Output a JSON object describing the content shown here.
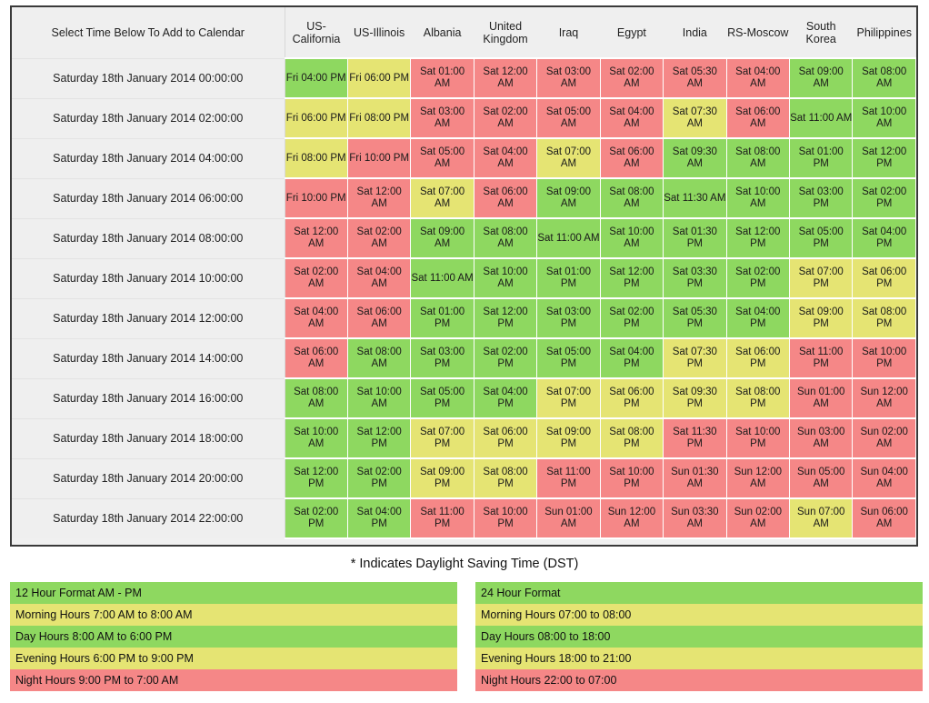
{
  "table": {
    "corner_header": "Select Time Below To Add to Calendar",
    "zone_headers": [
      "US-California",
      "US-Illinois",
      "Albania",
      "United Kingdom",
      "Iraq",
      "Egypt",
      "India",
      "RS-Moscow",
      "South Korea",
      "Philippines"
    ],
    "rows": [
      {
        "label": "Saturday 18th January 2014 00:00:00",
        "cells": [
          {
            "text": "Fri 04:00 PM",
            "color": "green"
          },
          {
            "text": "Fri 06:00 PM",
            "color": "yellow"
          },
          {
            "text": "Sat 01:00 AM",
            "color": "red"
          },
          {
            "text": "Sat 12:00 AM",
            "color": "red"
          },
          {
            "text": "Sat 03:00 AM",
            "color": "red"
          },
          {
            "text": "Sat 02:00 AM",
            "color": "red"
          },
          {
            "text": "Sat 05:30 AM",
            "color": "red"
          },
          {
            "text": "Sat 04:00 AM",
            "color": "red"
          },
          {
            "text": "Sat 09:00 AM",
            "color": "green"
          },
          {
            "text": "Sat 08:00 AM",
            "color": "green"
          }
        ]
      },
      {
        "label": "Saturday 18th January 2014 02:00:00",
        "cells": [
          {
            "text": "Fri 06:00 PM",
            "color": "yellow"
          },
          {
            "text": "Fri 08:00 PM",
            "color": "yellow"
          },
          {
            "text": "Sat 03:00 AM",
            "color": "red"
          },
          {
            "text": "Sat 02:00 AM",
            "color": "red"
          },
          {
            "text": "Sat 05:00 AM",
            "color": "red"
          },
          {
            "text": "Sat 04:00 AM",
            "color": "red"
          },
          {
            "text": "Sat 07:30 AM",
            "color": "yellow"
          },
          {
            "text": "Sat 06:00 AM",
            "color": "red"
          },
          {
            "text": "Sat 11:00 AM",
            "color": "green"
          },
          {
            "text": "Sat 10:00 AM",
            "color": "green"
          }
        ]
      },
      {
        "label": "Saturday 18th January 2014 04:00:00",
        "cells": [
          {
            "text": "Fri 08:00 PM",
            "color": "yellow"
          },
          {
            "text": "Fri 10:00 PM",
            "color": "red"
          },
          {
            "text": "Sat 05:00 AM",
            "color": "red"
          },
          {
            "text": "Sat 04:00 AM",
            "color": "red"
          },
          {
            "text": "Sat 07:00 AM",
            "color": "yellow"
          },
          {
            "text": "Sat 06:00 AM",
            "color": "red"
          },
          {
            "text": "Sat 09:30 AM",
            "color": "green"
          },
          {
            "text": "Sat 08:00 AM",
            "color": "green"
          },
          {
            "text": "Sat 01:00 PM",
            "color": "green"
          },
          {
            "text": "Sat 12:00 PM",
            "color": "green"
          }
        ]
      },
      {
        "label": "Saturday 18th January 2014 06:00:00",
        "cells": [
          {
            "text": "Fri 10:00 PM",
            "color": "red"
          },
          {
            "text": "Sat 12:00 AM",
            "color": "red"
          },
          {
            "text": "Sat 07:00 AM",
            "color": "yellow"
          },
          {
            "text": "Sat 06:00 AM",
            "color": "red"
          },
          {
            "text": "Sat 09:00 AM",
            "color": "green"
          },
          {
            "text": "Sat 08:00 AM",
            "color": "green"
          },
          {
            "text": "Sat 11:30 AM",
            "color": "green"
          },
          {
            "text": "Sat 10:00 AM",
            "color": "green"
          },
          {
            "text": "Sat 03:00 PM",
            "color": "green"
          },
          {
            "text": "Sat 02:00 PM",
            "color": "green"
          }
        ]
      },
      {
        "label": "Saturday 18th January 2014 08:00:00",
        "cells": [
          {
            "text": "Sat 12:00 AM",
            "color": "red"
          },
          {
            "text": "Sat 02:00 AM",
            "color": "red"
          },
          {
            "text": "Sat 09:00 AM",
            "color": "green"
          },
          {
            "text": "Sat 08:00 AM",
            "color": "green"
          },
          {
            "text": "Sat 11:00 AM",
            "color": "green"
          },
          {
            "text": "Sat 10:00 AM",
            "color": "green"
          },
          {
            "text": "Sat 01:30 PM",
            "color": "green"
          },
          {
            "text": "Sat 12:00 PM",
            "color": "green"
          },
          {
            "text": "Sat 05:00 PM",
            "color": "green"
          },
          {
            "text": "Sat 04:00 PM",
            "color": "green"
          }
        ]
      },
      {
        "label": "Saturday 18th January 2014 10:00:00",
        "cells": [
          {
            "text": "Sat 02:00 AM",
            "color": "red"
          },
          {
            "text": "Sat 04:00 AM",
            "color": "red"
          },
          {
            "text": "Sat 11:00 AM",
            "color": "green"
          },
          {
            "text": "Sat 10:00 AM",
            "color": "green"
          },
          {
            "text": "Sat 01:00 PM",
            "color": "green"
          },
          {
            "text": "Sat 12:00 PM",
            "color": "green"
          },
          {
            "text": "Sat 03:30 PM",
            "color": "green"
          },
          {
            "text": "Sat 02:00 PM",
            "color": "green"
          },
          {
            "text": "Sat 07:00 PM",
            "color": "yellow"
          },
          {
            "text": "Sat 06:00 PM",
            "color": "yellow"
          }
        ]
      },
      {
        "label": "Saturday 18th January 2014 12:00:00",
        "cells": [
          {
            "text": "Sat 04:00 AM",
            "color": "red"
          },
          {
            "text": "Sat 06:00 AM",
            "color": "red"
          },
          {
            "text": "Sat 01:00 PM",
            "color": "green"
          },
          {
            "text": "Sat 12:00 PM",
            "color": "green"
          },
          {
            "text": "Sat 03:00 PM",
            "color": "green"
          },
          {
            "text": "Sat 02:00 PM",
            "color": "green"
          },
          {
            "text": "Sat 05:30 PM",
            "color": "green"
          },
          {
            "text": "Sat 04:00 PM",
            "color": "green"
          },
          {
            "text": "Sat 09:00 PM",
            "color": "yellow"
          },
          {
            "text": "Sat 08:00 PM",
            "color": "yellow"
          }
        ]
      },
      {
        "label": "Saturday 18th January 2014 14:00:00",
        "cells": [
          {
            "text": "Sat 06:00 AM",
            "color": "red"
          },
          {
            "text": "Sat 08:00 AM",
            "color": "green"
          },
          {
            "text": "Sat 03:00 PM",
            "color": "green"
          },
          {
            "text": "Sat 02:00 PM",
            "color": "green"
          },
          {
            "text": "Sat 05:00 PM",
            "color": "green"
          },
          {
            "text": "Sat 04:00 PM",
            "color": "green"
          },
          {
            "text": "Sat 07:30 PM",
            "color": "yellow"
          },
          {
            "text": "Sat 06:00 PM",
            "color": "yellow"
          },
          {
            "text": "Sat 11:00 PM",
            "color": "red"
          },
          {
            "text": "Sat 10:00 PM",
            "color": "red"
          }
        ]
      },
      {
        "label": "Saturday 18th January 2014 16:00:00",
        "cells": [
          {
            "text": "Sat 08:00 AM",
            "color": "green"
          },
          {
            "text": "Sat 10:00 AM",
            "color": "green"
          },
          {
            "text": "Sat 05:00 PM",
            "color": "green"
          },
          {
            "text": "Sat 04:00 PM",
            "color": "green"
          },
          {
            "text": "Sat 07:00 PM",
            "color": "yellow"
          },
          {
            "text": "Sat 06:00 PM",
            "color": "yellow"
          },
          {
            "text": "Sat 09:30 PM",
            "color": "yellow"
          },
          {
            "text": "Sat 08:00 PM",
            "color": "yellow"
          },
          {
            "text": "Sun 01:00 AM",
            "color": "red"
          },
          {
            "text": "Sun 12:00 AM",
            "color": "red"
          }
        ]
      },
      {
        "label": "Saturday 18th January 2014 18:00:00",
        "cells": [
          {
            "text": "Sat 10:00 AM",
            "color": "green"
          },
          {
            "text": "Sat 12:00 PM",
            "color": "green"
          },
          {
            "text": "Sat 07:00 PM",
            "color": "yellow"
          },
          {
            "text": "Sat 06:00 PM",
            "color": "yellow"
          },
          {
            "text": "Sat 09:00 PM",
            "color": "yellow"
          },
          {
            "text": "Sat 08:00 PM",
            "color": "yellow"
          },
          {
            "text": "Sat 11:30 PM",
            "color": "red"
          },
          {
            "text": "Sat 10:00 PM",
            "color": "red"
          },
          {
            "text": "Sun 03:00 AM",
            "color": "red"
          },
          {
            "text": "Sun 02:00 AM",
            "color": "red"
          }
        ]
      },
      {
        "label": "Saturday 18th January 2014 20:00:00",
        "cells": [
          {
            "text": "Sat 12:00 PM",
            "color": "green"
          },
          {
            "text": "Sat 02:00 PM",
            "color": "green"
          },
          {
            "text": "Sat 09:00 PM",
            "color": "yellow"
          },
          {
            "text": "Sat 08:00 PM",
            "color": "yellow"
          },
          {
            "text": "Sat 11:00 PM",
            "color": "red"
          },
          {
            "text": "Sat 10:00 PM",
            "color": "red"
          },
          {
            "text": "Sun 01:30 AM",
            "color": "red"
          },
          {
            "text": "Sun 12:00 AM",
            "color": "red"
          },
          {
            "text": "Sun 05:00 AM",
            "color": "red"
          },
          {
            "text": "Sun 04:00 AM",
            "color": "red"
          }
        ]
      },
      {
        "label": "Saturday 18th January 2014 22:00:00",
        "cells": [
          {
            "text": "Sat 02:00 PM",
            "color": "green"
          },
          {
            "text": "Sat 04:00 PM",
            "color": "green"
          },
          {
            "text": "Sat 11:00 PM",
            "color": "red"
          },
          {
            "text": "Sat 10:00 PM",
            "color": "red"
          },
          {
            "text": "Sun 01:00 AM",
            "color": "red"
          },
          {
            "text": "Sun 12:00 AM",
            "color": "red"
          },
          {
            "text": "Sun 03:30 AM",
            "color": "red"
          },
          {
            "text": "Sun 02:00 AM",
            "color": "red"
          },
          {
            "text": "Sun 07:00 AM",
            "color": "yellow"
          },
          {
            "text": "Sun 06:00 AM",
            "color": "red"
          }
        ]
      }
    ]
  },
  "dst_note": "* Indicates Daylight Saving Time (DST)",
  "legend_12h": [
    {
      "text": "12 Hour Format AM - PM",
      "color": "green"
    },
    {
      "text": "Morning Hours 7:00 AM to 8:00 AM",
      "color": "yellow"
    },
    {
      "text": "Day Hours 8:00 AM to 6:00 PM",
      "color": "green"
    },
    {
      "text": "Evening Hours 6:00 PM to 9:00 PM",
      "color": "yellow"
    },
    {
      "text": "Night Hours 9:00 PM to 7:00 AM",
      "color": "red"
    }
  ],
  "legend_24h": [
    {
      "text": "24 Hour Format",
      "color": "green"
    },
    {
      "text": "Morning Hours 07:00 to 08:00",
      "color": "yellow"
    },
    {
      "text": "Day Hours 08:00 to 18:00",
      "color": "green"
    },
    {
      "text": "Evening Hours 18:00 to 21:00",
      "color": "yellow"
    },
    {
      "text": "Night Hours 22:00 to 07:00",
      "color": "red"
    }
  ],
  "colors": {
    "day_green": "#8ed860",
    "morning_evening_yellow": "#e5e473",
    "night_red": "#f58787",
    "header_bg": "#efefef",
    "frame_border": "#3a3a3a"
  }
}
